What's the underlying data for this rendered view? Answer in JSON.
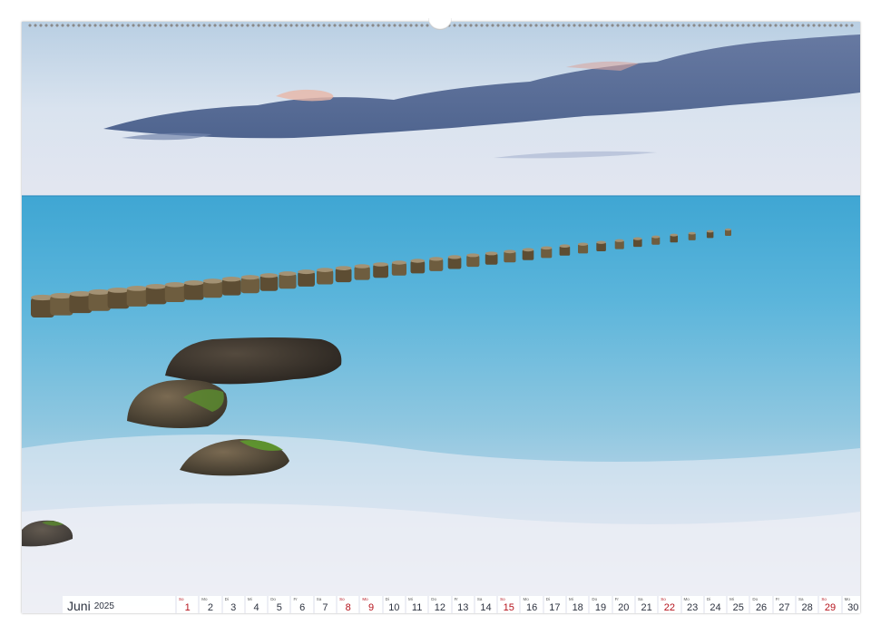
{
  "calendar": {
    "month": "Juni",
    "year": "2025",
    "colors": {
      "text": "#2d3340",
      "sunday": "#b5121b",
      "cell": "#ffffff"
    },
    "days": [
      {
        "wd": "So",
        "d": "1",
        "red": true
      },
      {
        "wd": "Mo",
        "d": "2"
      },
      {
        "wd": "Di",
        "d": "3"
      },
      {
        "wd": "Mi",
        "d": "4"
      },
      {
        "wd": "Do",
        "d": "5"
      },
      {
        "wd": "Fr",
        "d": "6"
      },
      {
        "wd": "Sa",
        "d": "7"
      },
      {
        "wd": "So",
        "d": "8",
        "red": true
      },
      {
        "wd": "Mo",
        "d": "9",
        "red": true
      },
      {
        "wd": "Di",
        "d": "10"
      },
      {
        "wd": "Mi",
        "d": "11"
      },
      {
        "wd": "Do",
        "d": "12"
      },
      {
        "wd": "Fr",
        "d": "13"
      },
      {
        "wd": "Sa",
        "d": "14"
      },
      {
        "wd": "So",
        "d": "15",
        "red": true
      },
      {
        "wd": "Mo",
        "d": "16"
      },
      {
        "wd": "Di",
        "d": "17"
      },
      {
        "wd": "Mi",
        "d": "18"
      },
      {
        "wd": "Do",
        "d": "19"
      },
      {
        "wd": "Fr",
        "d": "20"
      },
      {
        "wd": "Sa",
        "d": "21"
      },
      {
        "wd": "So",
        "d": "22",
        "red": true
      },
      {
        "wd": "Mo",
        "d": "23"
      },
      {
        "wd": "Di",
        "d": "24"
      },
      {
        "wd": "Mi",
        "d": "25"
      },
      {
        "wd": "Do",
        "d": "26"
      },
      {
        "wd": "Fr",
        "d": "27"
      },
      {
        "wd": "Sa",
        "d": "28"
      },
      {
        "wd": "So",
        "d": "29",
        "red": true
      },
      {
        "wd": "Mo",
        "d": "30"
      }
    ]
  },
  "photo": {
    "subject": "long-exposure-seascape-with-groyne-posts-and-rocks",
    "colors": {
      "sky_top": "#c9dcea",
      "cloud": "#4a6290",
      "sea": "#5fb6d8",
      "surf": "#e9edf3"
    }
  }
}
